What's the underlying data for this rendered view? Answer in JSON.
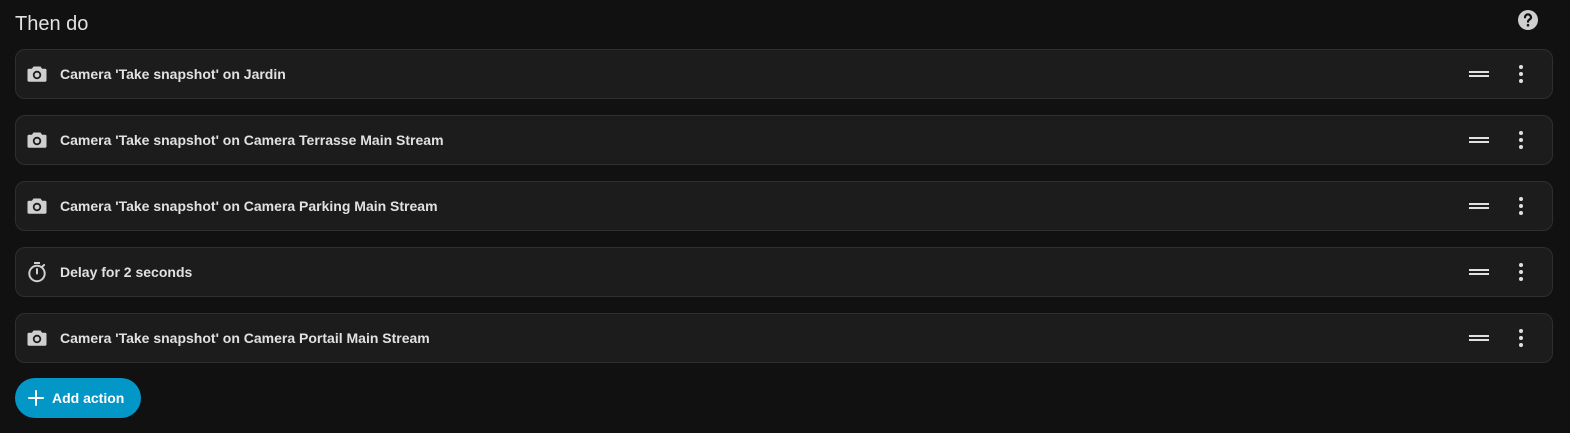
{
  "section": {
    "title": "Then do",
    "help_icon": "help-circle-icon"
  },
  "actions": [
    {
      "icon": "camera-icon",
      "label": "Camera 'Take snapshot' on Jardin"
    },
    {
      "icon": "camera-icon",
      "label": "Camera 'Take snapshot' on Camera Terrasse Main Stream"
    },
    {
      "icon": "camera-icon",
      "label": "Camera 'Take snapshot' on Camera Parking Main Stream"
    },
    {
      "icon": "timer-icon",
      "label": "Delay for 2 seconds"
    },
    {
      "icon": "camera-icon",
      "label": "Camera 'Take snapshot' on Camera Portail Main Stream"
    }
  ],
  "add_button": {
    "label": "Add action",
    "icon": "plus-icon"
  },
  "colors": {
    "background": "#111111",
    "card": "#1c1c1c",
    "card_border": "#2f2f2f",
    "accent": "#0397c8",
    "text": "#e1e1e1",
    "icon": "#cfcfcf"
  }
}
